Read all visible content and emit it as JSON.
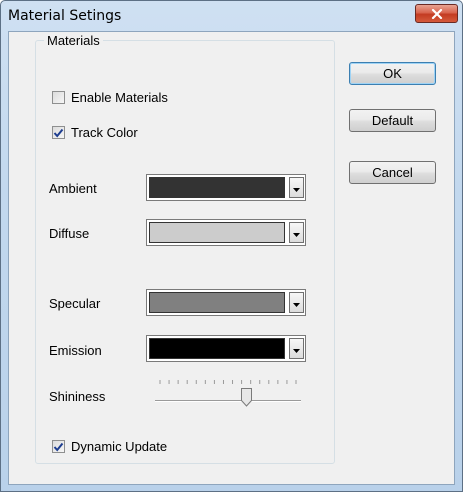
{
  "window": {
    "title": "Material Setings"
  },
  "group": {
    "label": "Materials"
  },
  "checkboxes": {
    "enable_materials": {
      "label": "Enable Materials",
      "checked": false
    },
    "track_color": {
      "label": "Track Color",
      "checked": true
    },
    "dynamic_update": {
      "label": "Dynamic Update",
      "checked": true
    }
  },
  "colors": [
    {
      "label": "Ambient",
      "value": "#333333"
    },
    {
      "label": "Diffuse",
      "value": "#cccccc"
    },
    {
      "label": "Specular",
      "value": "#808080"
    },
    {
      "label": "Emission",
      "value": "#000000"
    }
  ],
  "shininess": {
    "label": "Shininess",
    "value": 0.65,
    "tick_count": 16
  },
  "buttons": {
    "ok": "OK",
    "default": "Default",
    "cancel": "Cancel"
  },
  "icons": {
    "close": "close-icon",
    "dropdown": "chevron-down-icon",
    "check": "checkmark-icon"
  }
}
